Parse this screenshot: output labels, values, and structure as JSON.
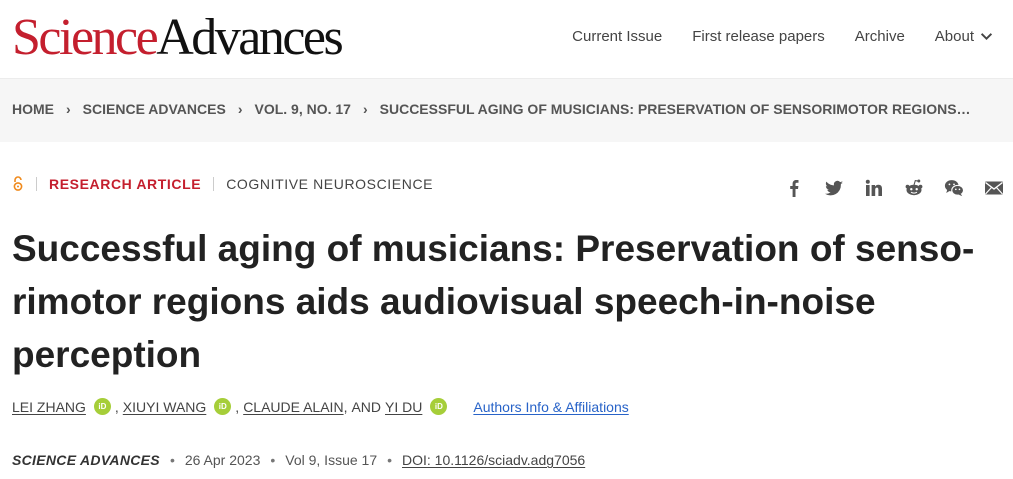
{
  "header": {
    "logo_science": "Science",
    "logo_advances": "Advances",
    "nav": [
      "Current Issue",
      "First release papers",
      "Archive"
    ],
    "about_label": "About"
  },
  "breadcrumb": {
    "items": [
      "HOME",
      "SCIENCE ADVANCES",
      "VOL. 9, NO. 17"
    ],
    "current": "SUCCESSFUL AGING OF MUSICIANS: PRESERVATION OF SENSORIMOTOR REGIONS…"
  },
  "article": {
    "type": "RESEARCH ARTICLE",
    "subject": "COGNITIVE NEUROSCIENCE",
    "title": "Successful aging of musicians: Preservation of senso­rimotor regions aids audiovisual speech-in-noise perception",
    "authors": [
      "LEI ZHANG",
      "XIUYI WANG",
      "CLAUDE ALAIN",
      "YI DU"
    ],
    "and_label": "AND",
    "orcid_label": "iD",
    "affiliations_label": "Authors Info & Affiliations",
    "citation": {
      "journal": "SCIENCE ADVANCES",
      "date": "26 Apr 2023",
      "volume": "Vol 9, Issue 17",
      "doi": "DOI: 10.1126/sciadv.adg7056"
    }
  },
  "colors": {
    "brand_red": "#c41f2e",
    "open_access_orange": "#f08a1c",
    "orcid_green": "#a6ce39",
    "link_blue": "#2863c8"
  },
  "share_icons": [
    "facebook-icon",
    "twitter-icon",
    "linkedin-icon",
    "reddit-icon",
    "wechat-icon",
    "email-icon"
  ]
}
